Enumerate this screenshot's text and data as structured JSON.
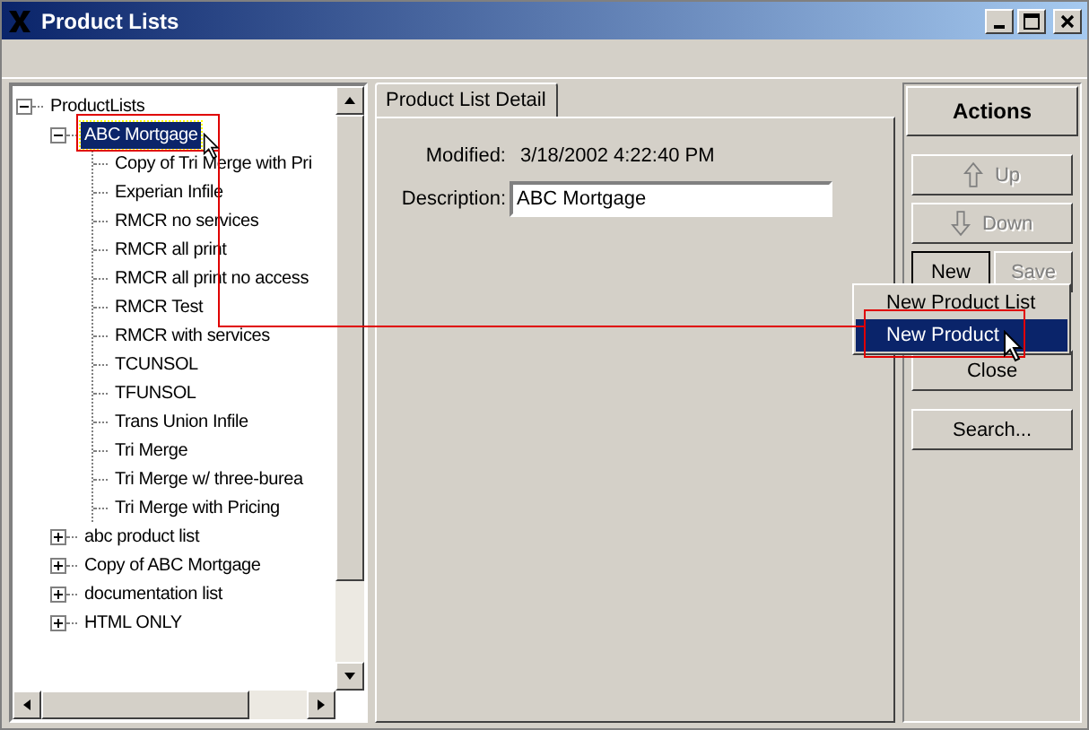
{
  "window": {
    "title": "Product Lists"
  },
  "tree": {
    "items": [
      {
        "label": "ProductLists",
        "kind": "root",
        "expanded": true,
        "selected": false,
        "children": [
          {
            "label": "ABC Mortgage",
            "kind": "list",
            "expanded": true,
            "selected": true,
            "children": [
              {
                "label": "Copy of Tri Merge with Pri",
                "selected": false
              },
              {
                "label": "Experian Infile",
                "selected": false
              },
              {
                "label": "RMCR  no services",
                "selected": false
              },
              {
                "label": "RMCR all print",
                "selected": false
              },
              {
                "label": "RMCR all print no access",
                "selected": false
              },
              {
                "label": "RMCR Test",
                "selected": false
              },
              {
                "label": "RMCR with services",
                "selected": false
              },
              {
                "label": "TCUNSOL",
                "selected": false
              },
              {
                "label": "TFUNSOL",
                "selected": false
              },
              {
                "label": "Trans Union Infile",
                "selected": false
              },
              {
                "label": "Tri Merge",
                "selected": false
              },
              {
                "label": "Tri Merge w/ three-burea",
                "selected": false
              },
              {
                "label": "Tri Merge with Pricing",
                "selected": false
              }
            ]
          },
          {
            "label": "abc product list",
            "kind": "list",
            "expanded": false,
            "selected": false
          },
          {
            "label": "Copy of ABC Mortgage",
            "kind": "list",
            "expanded": false,
            "selected": false
          },
          {
            "label": "documentation list",
            "kind": "list",
            "expanded": false,
            "selected": false
          },
          {
            "label": "HTML ONLY",
            "kind": "list",
            "expanded": false,
            "selected": false
          }
        ]
      }
    ]
  },
  "detail": {
    "tabs": [
      {
        "label": "Product List Detail",
        "selected": true
      }
    ],
    "modified_label": "Modified:",
    "modified_value": "3/18/2002 4:22:40 PM",
    "description_label": "Description:",
    "description_value": "ABC Mortgage"
  },
  "actions": {
    "title": "Actions",
    "buttons": [
      {
        "label": "Up",
        "kind": "up",
        "disabled": true,
        "focused": false
      },
      {
        "label": "Down",
        "kind": "down",
        "disabled": true,
        "focused": false
      },
      {
        "label": "New",
        "kind": "half",
        "disabled": false,
        "focused": true
      },
      {
        "label": "Save",
        "kind": "half",
        "disabled": true,
        "focused": false
      },
      {
        "label": "Close",
        "kind": "wide",
        "disabled": false,
        "focused": false
      },
      {
        "label": "Search...",
        "kind": "wide",
        "disabled": false,
        "focused": false
      }
    ]
  },
  "menu": {
    "items": [
      {
        "label": "New Product List",
        "selected": false
      },
      {
        "label": "New Product",
        "selected": true
      }
    ]
  }
}
